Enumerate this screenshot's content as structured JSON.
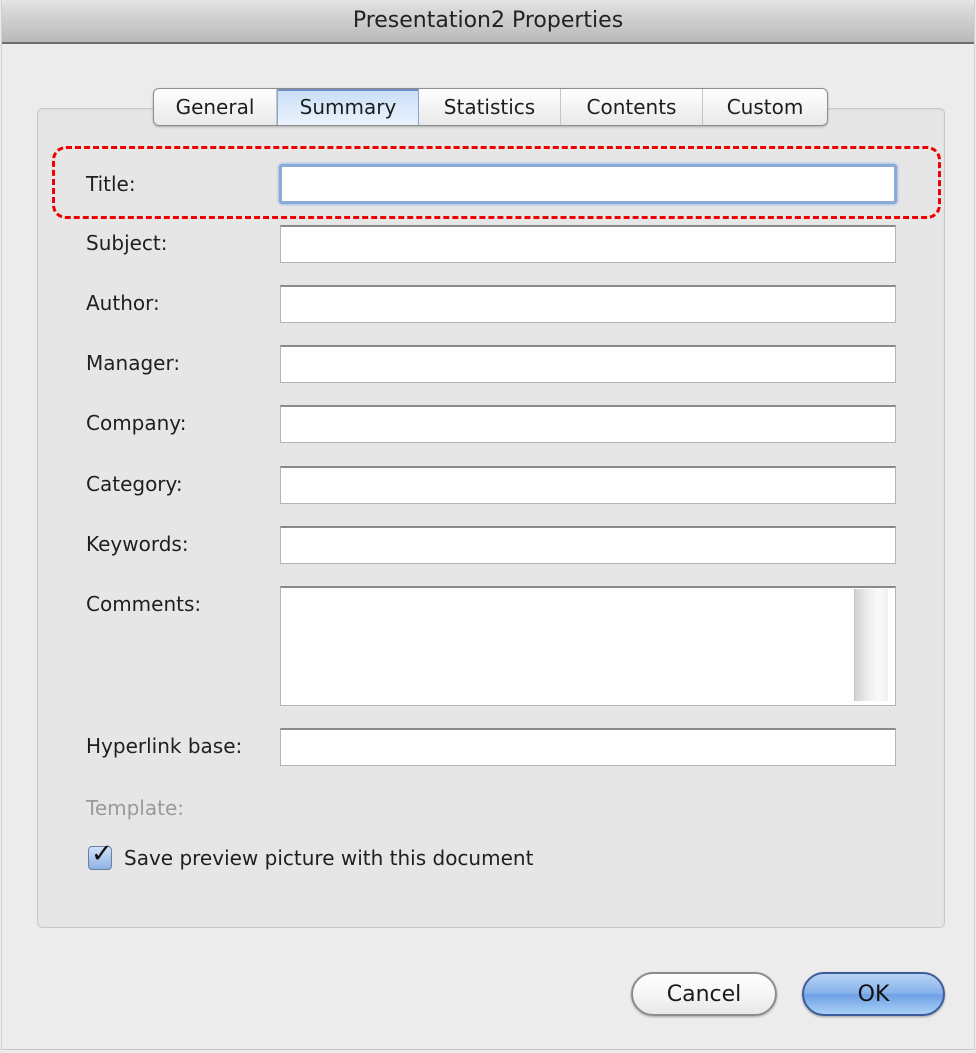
{
  "window": {
    "title": "Presentation2 Properties"
  },
  "tabs": [
    {
      "label": "General",
      "selected": false
    },
    {
      "label": "Summary",
      "selected": true
    },
    {
      "label": "Statistics",
      "selected": false
    },
    {
      "label": "Contents",
      "selected": false
    },
    {
      "label": "Custom",
      "selected": false
    }
  ],
  "fields": {
    "title": {
      "label": "Title:",
      "value": ""
    },
    "subject": {
      "label": "Subject:",
      "value": ""
    },
    "author": {
      "label": "Author:",
      "value": ""
    },
    "manager": {
      "label": "Manager:",
      "value": ""
    },
    "company": {
      "label": "Company:",
      "value": ""
    },
    "category": {
      "label": "Category:",
      "value": ""
    },
    "keywords": {
      "label": "Keywords:",
      "value": ""
    },
    "comments": {
      "label": "Comments:",
      "value": ""
    },
    "hyperlink_base": {
      "label": "Hyperlink base:",
      "value": ""
    },
    "template": {
      "label": "Template:",
      "value": ""
    }
  },
  "save_preview": {
    "label": "Save preview picture with this document",
    "checked": true
  },
  "buttons": {
    "cancel": "Cancel",
    "ok": "OK"
  },
  "annotation": {
    "highlight_color": "#ee0000",
    "highlighted_field": "title"
  }
}
